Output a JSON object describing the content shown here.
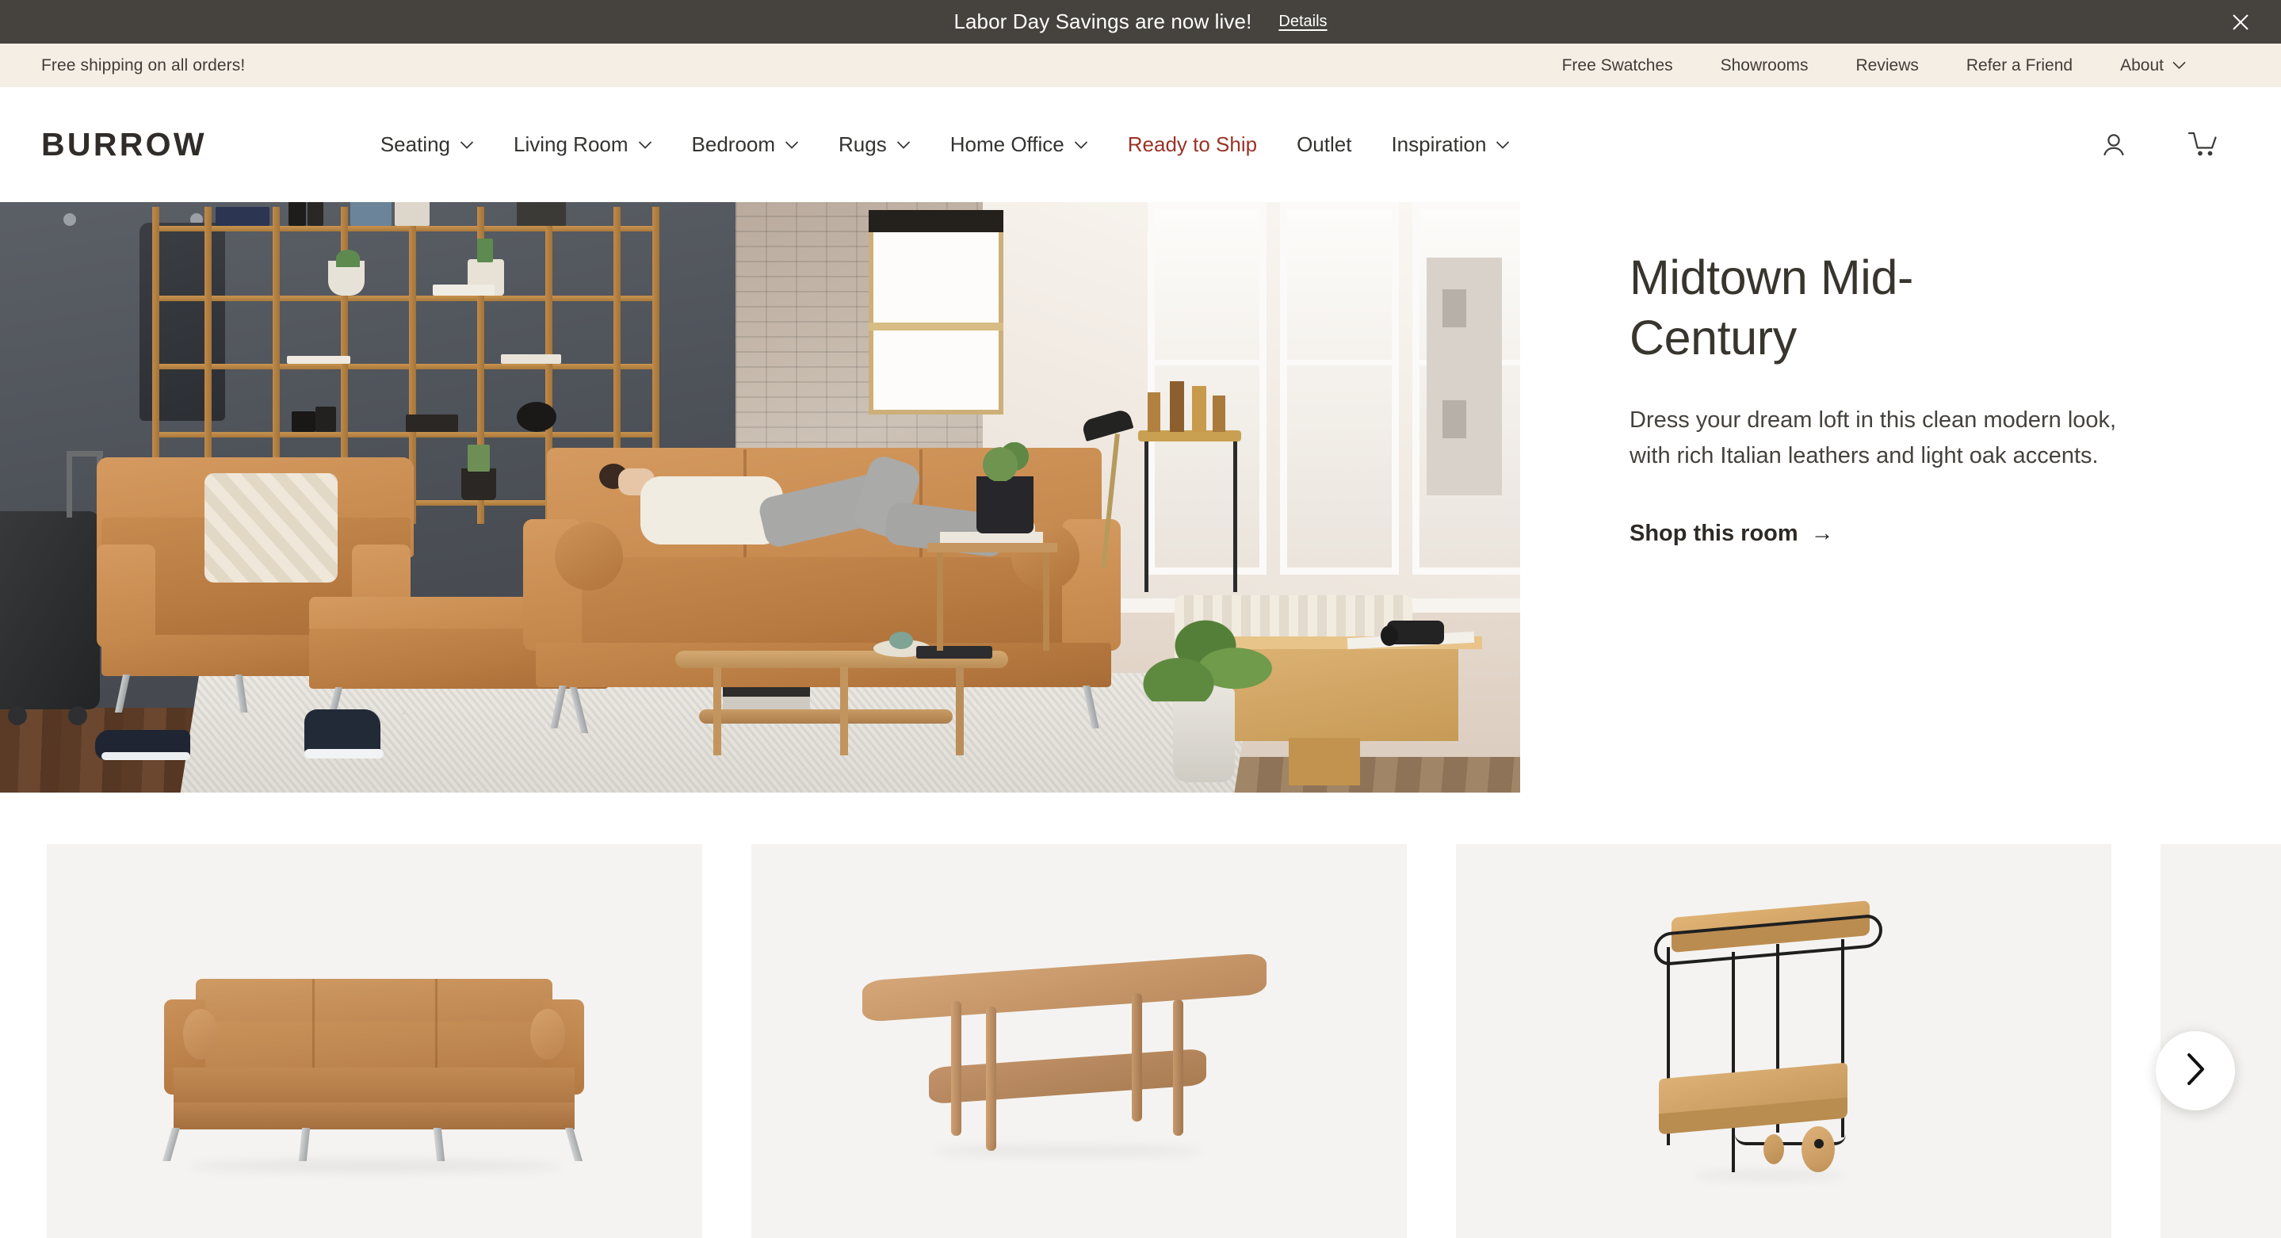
{
  "announcement": {
    "text": "Labor Day Savings are now live!",
    "details_label": "Details",
    "close_icon": "close-icon",
    "bg_color": "#46423d"
  },
  "utility_bar": {
    "promo": "Free shipping on all orders!",
    "bg_color": "#f5eee5",
    "links": [
      {
        "label": "Free Swatches",
        "has_caret": false
      },
      {
        "label": "Showrooms",
        "has_caret": false
      },
      {
        "label": "Reviews",
        "has_caret": false
      },
      {
        "label": "Refer a Friend",
        "has_caret": false
      },
      {
        "label": "About",
        "has_caret": true
      }
    ]
  },
  "main_nav": {
    "logo": "BURROW",
    "accent_color": "#9b3227",
    "items": [
      {
        "label": "Seating",
        "has_caret": true,
        "accent": false
      },
      {
        "label": "Living Room",
        "has_caret": true,
        "accent": false
      },
      {
        "label": "Bedroom",
        "has_caret": true,
        "accent": false
      },
      {
        "label": "Rugs",
        "has_caret": true,
        "accent": false
      },
      {
        "label": "Home Office",
        "has_caret": true,
        "accent": false
      },
      {
        "label": "Ready to Ship",
        "has_caret": false,
        "accent": true
      },
      {
        "label": "Outlet",
        "has_caret": false,
        "accent": false
      },
      {
        "label": "Inspiration",
        "has_caret": true,
        "accent": false
      }
    ],
    "account_icon": "account-person-icon",
    "cart_icon": "shopping-cart-icon"
  },
  "hero": {
    "title": "Midtown Mid-Century",
    "description": "Dress your dream loft in this clean modern look, with rich Italian leathers and light oak accents.",
    "cta_label": "Shop this room",
    "cta_arrow": "→",
    "image_alt": "Loft living room with tan leather sofa, armchair, ottoman, oak coffee table and bookshelf"
  },
  "carousel": {
    "next_icon": "chevron-right-icon",
    "cards": [
      {
        "alt": "Tan leather three-seat sofa with chrome legs"
      },
      {
        "alt": "Two-tier oak coffee table"
      },
      {
        "alt": "Oak and black metal bar cart with wheels"
      },
      {
        "alt": "Next product preview"
      }
    ]
  }
}
